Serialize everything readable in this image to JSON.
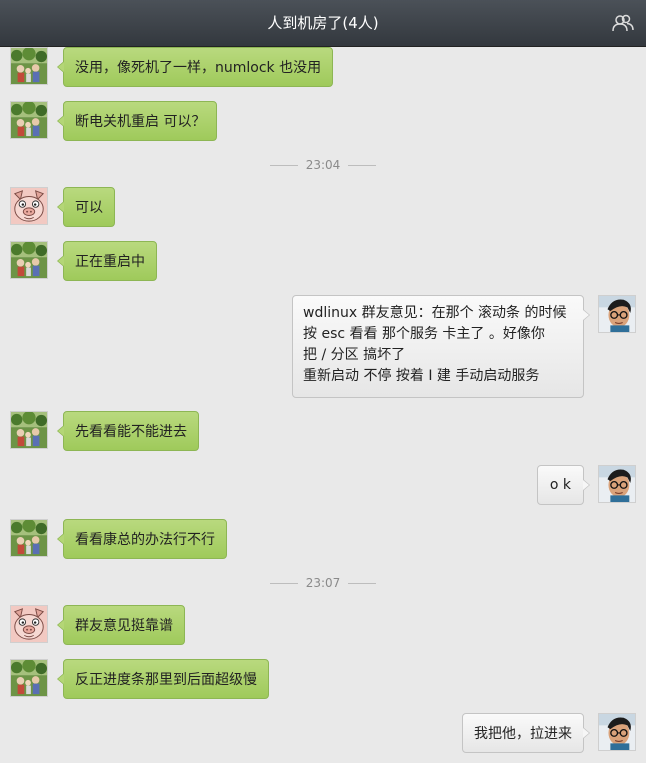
{
  "header": {
    "title": "人到机房了(4人)",
    "group_icon": "group-members-icon"
  },
  "timestamps": [
    "23:04",
    "23:07"
  ],
  "messages": [
    {
      "side": "left",
      "sender": "forest",
      "text": "没用，像死机了一样，numlock 也没用"
    },
    {
      "side": "left",
      "sender": "forest",
      "text": "断电关机重启 可以？"
    },
    {
      "side": "left",
      "sender": "pig",
      "text": "可以"
    },
    {
      "side": "left",
      "sender": "forest",
      "text": "正在重启中"
    },
    {
      "side": "right",
      "sender": "me",
      "text": "wdlinux 群友意见：在那个 滚动条 的时候\n按 esc  看看 那个服务 卡主了      。好像你\n把 / 分区 搞坏了\n重新启动 不停 按着 I 建  手动启动服务"
    },
    {
      "side": "left",
      "sender": "forest",
      "text": "先看看能不能进去"
    },
    {
      "side": "right",
      "sender": "me",
      "text": "o k"
    },
    {
      "side": "left",
      "sender": "forest",
      "text": "看看康总的办法行不行"
    },
    {
      "side": "left",
      "sender": "pig",
      "text": "群友意见挺靠谱"
    },
    {
      "side": "left",
      "sender": "forest",
      "text": "反正进度条那里到后面超级慢"
    },
    {
      "side": "right",
      "sender": "me",
      "text": "我把他，拉进来"
    }
  ],
  "avatars": {
    "forest": "forest-photo-avatar",
    "pig": "cartoon-pig-avatar",
    "me": "man-with-glasses-avatar"
  },
  "colors": {
    "header": "#3f454c",
    "bubble_left": "#aed26c",
    "bubble_right": "#f2f2f2",
    "background": "#e9e9e9"
  }
}
